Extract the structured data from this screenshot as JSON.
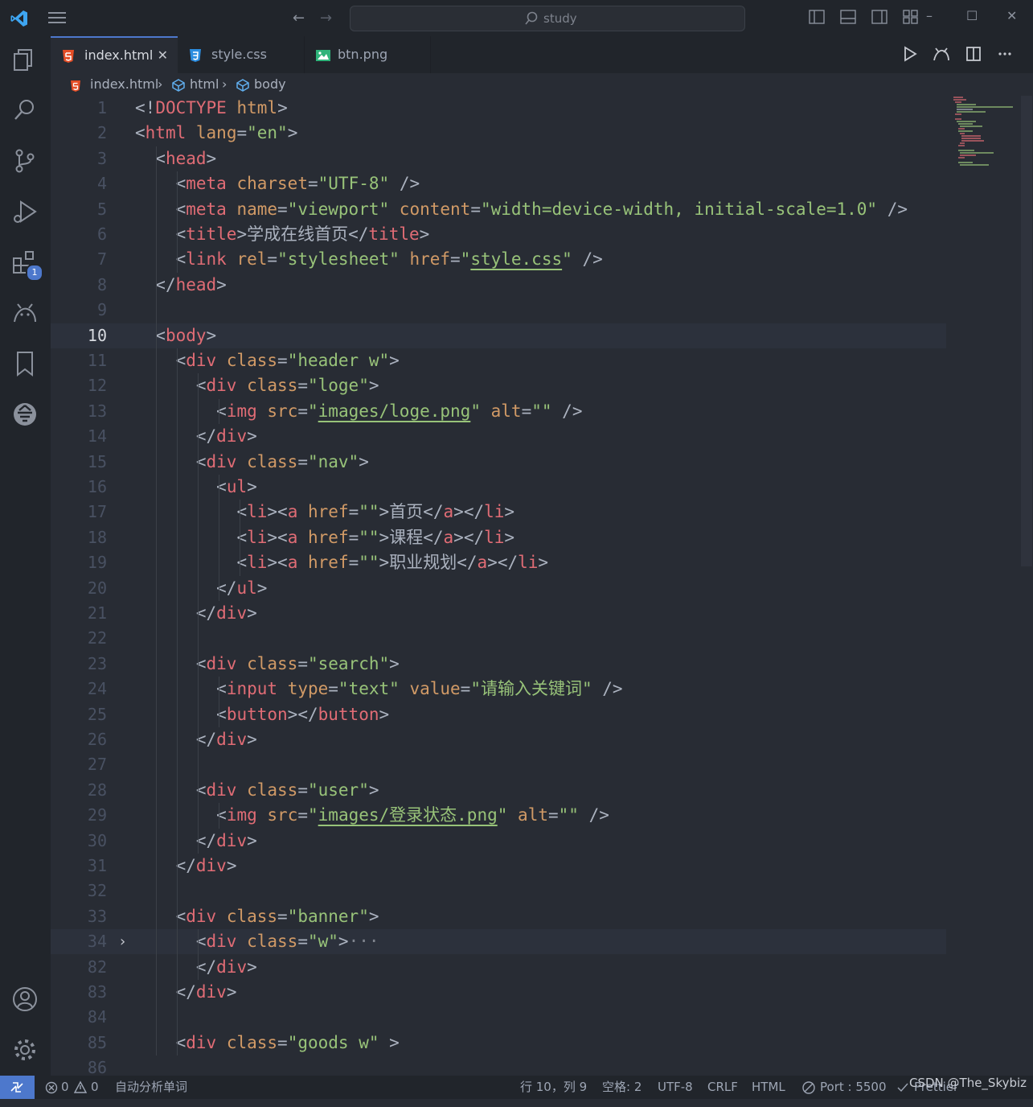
{
  "titlebar": {
    "search_placeholder": "study"
  },
  "activity": {
    "extensions_badge": "1"
  },
  "tabs": [
    {
      "label": "index.html",
      "close": "✕"
    },
    {
      "label": "style.css"
    },
    {
      "label": "btn.png"
    }
  ],
  "breadcrumb": {
    "file": "index.html",
    "sep1": "›",
    "html": "html",
    "sep2": "›",
    "body": "body"
  },
  "editor": {
    "current_line": "10",
    "fold_marker": "›",
    "lines": [
      {
        "n": "1",
        "t": "<!DOCTYPE html>"
      },
      {
        "n": "2",
        "t": "<html lang=\"en\">"
      },
      {
        "n": "3",
        "t": "  <head>"
      },
      {
        "n": "4",
        "t": "    <meta charset=\"UTF-8\" />"
      },
      {
        "n": "5",
        "t": "    <meta name=\"viewport\" content=\"width=device-width, initial-scale=1.0\" />"
      },
      {
        "n": "6",
        "t": "    <title>学成在线首页</title>"
      },
      {
        "n": "7",
        "t": "    <link rel=\"stylesheet\" href=\"style.css\" />"
      },
      {
        "n": "8",
        "t": "  </head>"
      },
      {
        "n": "9",
        "t": ""
      },
      {
        "n": "10",
        "t": "  <body>"
      },
      {
        "n": "11",
        "t": "    <div class=\"header w\">"
      },
      {
        "n": "12",
        "t": "      <div class=\"loge\">"
      },
      {
        "n": "13",
        "t": "        <img src=\"images/loge.png\" alt=\"\" />"
      },
      {
        "n": "14",
        "t": "      </div>"
      },
      {
        "n": "15",
        "t": "      <div class=\"nav\">"
      },
      {
        "n": "16",
        "t": "        <ul>"
      },
      {
        "n": "17",
        "t": "          <li><a href=\"\">首页</a></li>"
      },
      {
        "n": "18",
        "t": "          <li><a href=\"\">课程</a></li>"
      },
      {
        "n": "19",
        "t": "          <li><a href=\"\">职业规划</a></li>"
      },
      {
        "n": "20",
        "t": "        </ul>"
      },
      {
        "n": "21",
        "t": "      </div>"
      },
      {
        "n": "22",
        "t": ""
      },
      {
        "n": "23",
        "t": "      <div class=\"search\">"
      },
      {
        "n": "24",
        "t": "        <input type=\"text\" value=\"请输入关键词\" />"
      },
      {
        "n": "25",
        "t": "        <button></button>"
      },
      {
        "n": "26",
        "t": "      </div>"
      },
      {
        "n": "27",
        "t": ""
      },
      {
        "n": "28",
        "t": "      <div class=\"user\">"
      },
      {
        "n": "29",
        "t": "        <img src=\"images/登录状态.png\" alt=\"\" />"
      },
      {
        "n": "30",
        "t": "      </div>"
      },
      {
        "n": "31",
        "t": "    </div>"
      },
      {
        "n": "32",
        "t": ""
      },
      {
        "n": "33",
        "t": "    <div class=\"banner\">"
      },
      {
        "n": "34",
        "t": "      <div class=\"w\">···"
      },
      {
        "n": "82",
        "t": "      </div>"
      },
      {
        "n": "83",
        "t": "    </div>"
      },
      {
        "n": "84",
        "t": ""
      },
      {
        "n": "85",
        "t": "    <div class=\"goods w\" >"
      },
      {
        "n": "86",
        "t": ""
      }
    ]
  },
  "statusbar": {
    "errors": "0",
    "warnings": "0",
    "spell": "自动分析单词",
    "position": "行 10，列 9",
    "spaces": "空格: 2",
    "encoding": "UTF-8",
    "eol": "CRLF",
    "language": "HTML",
    "port": "Port : 5500",
    "prettier": "Prettier",
    "watermark": "CSDN @The_Skybiz"
  },
  "colors": {
    "background": "#282c34",
    "tag": "#e06c75",
    "attribute": "#d19a66",
    "string": "#98c379",
    "accent": "#4d78cc"
  }
}
